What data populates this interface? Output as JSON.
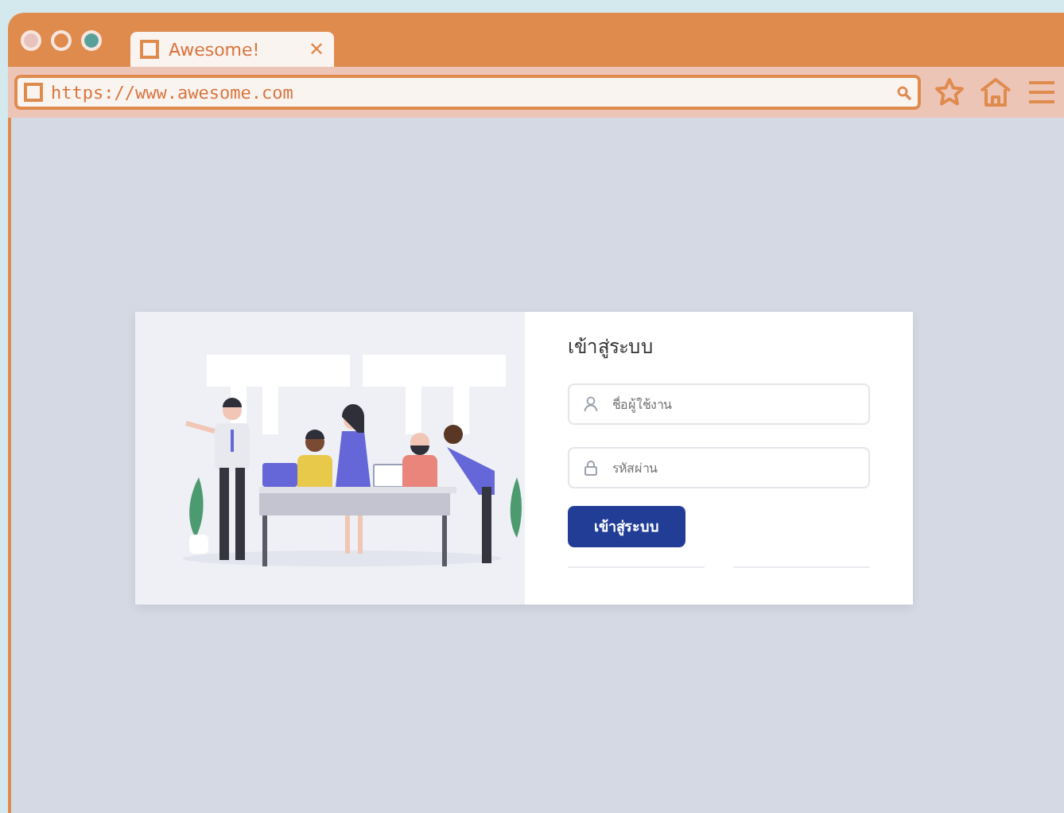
{
  "browser": {
    "tab": {
      "title": "Awesome!",
      "close": "✕"
    },
    "address": "https://www.awesome.com"
  },
  "login": {
    "title": "เข้าสู่ระบบ",
    "fields": [
      {
        "kind": "user",
        "placeholder": "ชื่อผู้ใช้งาน"
      },
      {
        "kind": "lock",
        "placeholder": "รหัสผ่าน"
      }
    ],
    "button": "เข้าสู่ระบบ"
  }
}
